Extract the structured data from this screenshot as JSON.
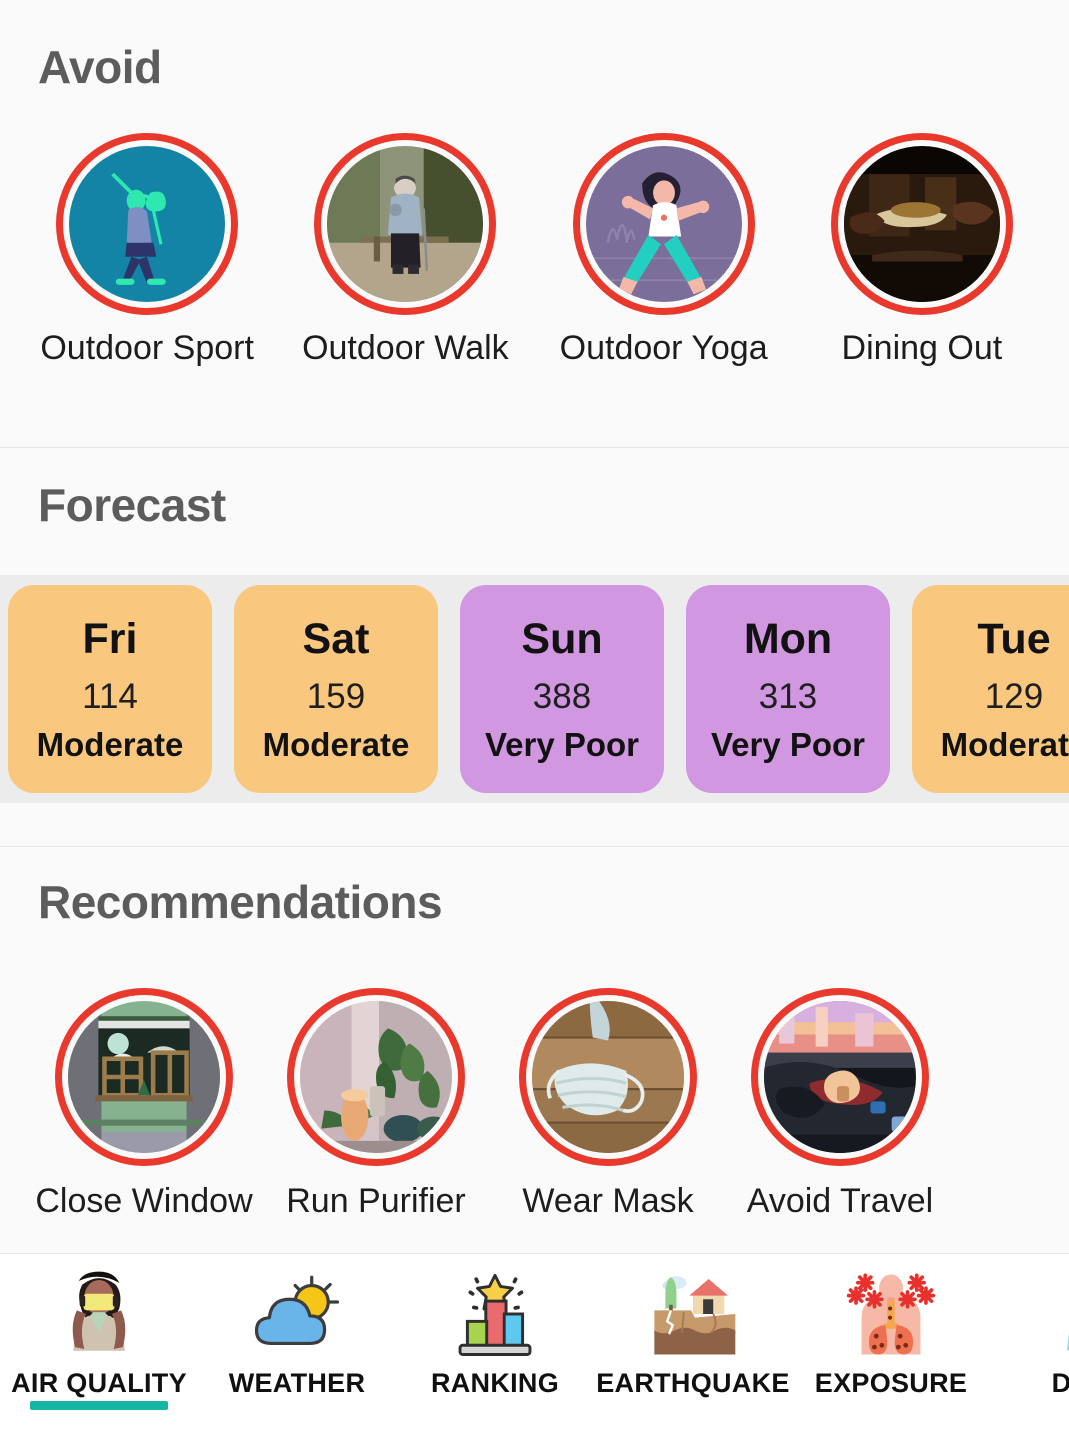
{
  "avoid": {
    "title": "Avoid",
    "items": [
      {
        "label": "Outdoor Sport",
        "icon": "golfer-icon"
      },
      {
        "label": "Outdoor Walk",
        "icon": "walking-person-icon"
      },
      {
        "label": "Outdoor Yoga",
        "icon": "yoga-person-icon"
      },
      {
        "label": "Dining Out",
        "icon": "dining-plate-icon"
      }
    ],
    "ring_color": "#e8392c"
  },
  "forecast": {
    "title": "Forecast",
    "strip_background": "#ececec",
    "level_colors": {
      "Moderate": "#fac77e",
      "Very Poor": "#d197e0"
    },
    "days": [
      {
        "day": "Fri",
        "aqi": "114",
        "level": "Moderate",
        "color": "#fac77e"
      },
      {
        "day": "Sat",
        "aqi": "159",
        "level": "Moderate",
        "color": "#fac77e"
      },
      {
        "day": "Sun",
        "aqi": "388",
        "level": "Very Poor",
        "color": "#d197e0"
      },
      {
        "day": "Mon",
        "aqi": "313",
        "level": "Very Poor",
        "color": "#d197e0"
      },
      {
        "day": "Tue",
        "aqi": "129",
        "level": "Moderate",
        "color": "#fac77e"
      }
    ]
  },
  "recommendations": {
    "title": "Recommendations",
    "items": [
      {
        "label": "Close Window",
        "icon": "window-icon"
      },
      {
        "label": "Run Purifier",
        "icon": "air-purifier-plants-icon"
      },
      {
        "label": "Wear Mask",
        "icon": "face-mask-icon"
      },
      {
        "label": "Avoid Travel",
        "icon": "steering-wheel-icon"
      }
    ],
    "ring_color": "#e8392c"
  },
  "bottom_nav": {
    "active_index": 0,
    "active_color": "#17b5a4",
    "items": [
      {
        "label": "AIR QUALITY",
        "icon": "person-mask-icon"
      },
      {
        "label": "WEATHER",
        "icon": "sun-cloud-icon"
      },
      {
        "label": "RANKING",
        "icon": "podium-star-icon"
      },
      {
        "label": "EARTHQUAKE",
        "icon": "earthquake-house-icon"
      },
      {
        "label": "EXPOSURE",
        "icon": "lungs-virus-icon"
      },
      {
        "label": "DUST",
        "icon": "dust-layers-icon"
      }
    ]
  }
}
